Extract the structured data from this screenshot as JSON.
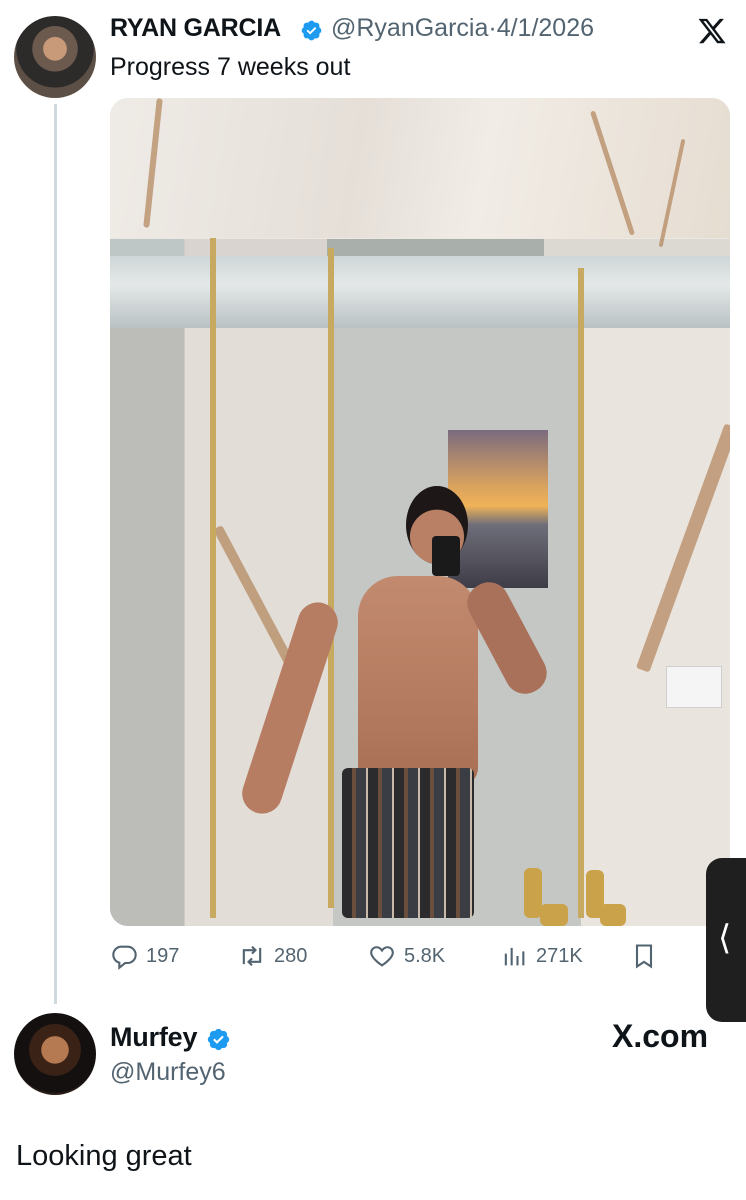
{
  "tweet": {
    "author_name": "RYAN GARCIA",
    "handle": "@RyanGarcia",
    "date_sep": "·",
    "date": "4/1/2026",
    "text": "Progress 7 weeks out",
    "avatar_icon": "ryan-avatar",
    "verified_icon": "verified-badge-icon",
    "actions": {
      "replies": "197",
      "reposts": "280",
      "likes": "5.8K",
      "views": "271K"
    }
  },
  "reply": {
    "author_name": "Murfey",
    "handle": "@Murfey6",
    "text": "Looking great",
    "watermark": "X.com"
  },
  "colors": {
    "text": "#0f1419",
    "secondary": "#536471",
    "verified_blue": "#1d9bf0",
    "thread_line": "#cfd9de"
  }
}
